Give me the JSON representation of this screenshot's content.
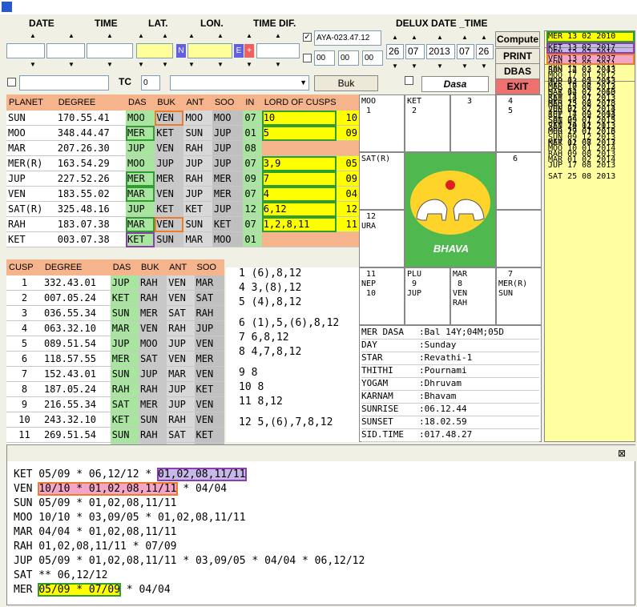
{
  "top_labels": {
    "date": "DATE",
    "time": "TIME",
    "lat": "LAT.",
    "lon": "LON.",
    "time_dif": "TIME DIF.",
    "delux": "DELUX DATE _TIME"
  },
  "inputs": {
    "ayanamsa": "AYA-023.47.12",
    "t1": "00",
    "t2": "00",
    "t3": "00",
    "dd": "26",
    "mm": "07",
    "yyyy": "2013",
    "hh": "07",
    "min": "26",
    "tc_label": "TC",
    "tc_value": "0",
    "n_badge": "N",
    "e_badge": "E",
    "plus": "+"
  },
  "buttons": {
    "compute": "Compute",
    "print": "PRINT",
    "dbas": "DBAS",
    "exit": "EXIT",
    "buk": "Buk",
    "dasa": "Dasa"
  },
  "planet_table": {
    "headers": [
      "PLANET",
      "DEGREE",
      "DAS",
      "BUK",
      "ANT",
      "SOO",
      "IN",
      "LORD OF CUSPS"
    ],
    "rows": [
      [
        "SUN",
        "170.55.41",
        "MOO",
        "VEN",
        "MOO",
        "MOO",
        "07",
        "10",
        "10"
      ],
      [
        "MOO",
        "348.44.47",
        "MER",
        "KET",
        "SUN",
        "JUP",
        "01",
        "5",
        "09"
      ],
      [
        "MAR",
        "207.26.30",
        "JUP",
        "VEN",
        "RAH",
        "JUP",
        "08",
        "",
        ""
      ],
      [
        "MER(R)",
        "163.54.29",
        "MOO",
        "JUP",
        "JUP",
        "JUP",
        "07",
        "3,9",
        "05"
      ],
      [
        "JUP",
        "227.52.26",
        "MER",
        "MER",
        "RAH",
        "MER",
        "09",
        "7",
        "09"
      ],
      [
        "VEN",
        "183.55.02",
        "MAR",
        "VEN",
        "JUP",
        "MER",
        "07",
        "4",
        "04"
      ],
      [
        "SAT(R)",
        "325.48.16",
        "JUP",
        "KET",
        "KET",
        "JUP",
        "12",
        "6,12",
        "12"
      ],
      [
        "RAH",
        "183.07.38",
        "MAR",
        "VEN",
        "SUN",
        "KET",
        "07",
        "1,2,8,11",
        "11"
      ],
      [
        "KET",
        "003.07.38",
        "KET",
        "SUN",
        "MAR",
        "MOO",
        "01",
        "",
        ""
      ]
    ]
  },
  "cusp_table": {
    "headers": [
      "CUSP",
      "DEGREE",
      "DAS",
      "BUK",
      "ANT",
      "SOO"
    ],
    "rows": [
      [
        "1",
        "332.43.01",
        "JUP",
        "RAH",
        "VEN",
        "MAR"
      ],
      [
        "2",
        "007.05.24",
        "KET",
        "RAH",
        "VEN",
        "SAT"
      ],
      [
        "3",
        "036.55.34",
        "SUN",
        "MER",
        "SAT",
        "RAH"
      ],
      [
        "4",
        "063.32.10",
        "MAR",
        "VEN",
        "RAH",
        "JUP"
      ],
      [
        "5",
        "089.51.54",
        "JUP",
        "MOO",
        "JUP",
        "VEN"
      ],
      [
        "6",
        "118.57.55",
        "MER",
        "SAT",
        "VEN",
        "MER"
      ],
      [
        "7",
        "152.43.01",
        "SUN",
        "JUP",
        "MAR",
        "VEN"
      ],
      [
        "8",
        "187.05.24",
        "RAH",
        "RAH",
        "JUP",
        "KET"
      ],
      [
        "9",
        "216.55.34",
        "SAT",
        "MER",
        "JUP",
        "VEN"
      ],
      [
        "10",
        "243.32.10",
        "KET",
        "SUN",
        "RAH",
        "VEN"
      ],
      [
        "11",
        "269.51.54",
        "SUN",
        "RAH",
        "SAT",
        "KET"
      ],
      [
        "12",
        "298.57.55",
        "MAR",
        "SAT",
        "VEN",
        "MER"
      ]
    ]
  },
  "cusp_significators": [
    "1 (6),8,12",
    "4 3,(8),12",
    "5 (4),8,12",
    "6 (1),5,(6),8,12",
    "7 6,8,12",
    "8 4,7,8,12",
    "9 8",
    "10 8",
    "11 8,12",
    "12 5,(6),7,8,12"
  ],
  "chart_cells": {
    "c00": "MOO\n 1",
    "c01": "KET\n 2",
    "c02": "   3",
    "c03": "  4\n  5",
    "c10": "SAT(R)",
    "c13": "   6",
    "c20": " 12\nURA",
    "c30": " 11\nNEP\n 10",
    "c31": "PLU\n 9\nJUP",
    "c32": "MAR\n 8\nVEN\nRAH",
    "c33": "  7\nMER(R)\nSUN",
    "center": "BHAVA"
  },
  "info": [
    [
      "MER DASA",
      ":Bal 14Y;04M;05D"
    ],
    [
      "DAY",
      ":Sunday"
    ],
    [
      "STAR",
      ":Revathi-1"
    ],
    [
      "THITHI",
      ":Pournami"
    ],
    [
      "YOGAM",
      ":Dhruvam"
    ],
    [
      "KARNAM",
      ":Bhavam"
    ],
    [
      "SUNRISE",
      ":06.12.44"
    ],
    [
      "SUNSET",
      ":18.02.59"
    ],
    [
      "SID.TIME",
      ":017.48.27"
    ]
  ],
  "dasa_list": {
    "g1": [
      "MER 13 02 2010",
      "KET 13 02 2017",
      "VEN 13 02 2037",
      "SUN 14 02 2043",
      "MOO 13 02 2053",
      "MAR 14 02 2060",
      "RAH 13 02 2078",
      "JUP 14 02 2094",
      "SAT 14 02 2113"
    ],
    "g2": [
      "VEN 12 07 2010",
      "SUN 12 09 2011",
      "MOO 17 01 2012",
      "MAR 17 08 2012",
      "RAH 14 01 2013",
      "JUP 01 02 2014",
      "SAT 09 01 2015",
      "MER 17 01 2016",
      "KET 12 07 2017"
    ],
    "g3": [
      "RAH 12 03 2013",
      "JUP 02 05 2013",
      "SAT 02 07 2013",
      "MER 25 08 2013",
      "KET 17 09 2013",
      "VEN 20 11 2013",
      "SUN 09 12 2013",
      "MOO 10 01 2014",
      "MAR 01 02 2014"
    ],
    "g4": [
      "MER 10 07 2013",
      "KET 13 07 2013",
      "VEN 22 07 2013",
      "SUN 25 07 2013",
      "MOO 29 07 2013",
      "MAR 01 08 2013",
      "RAH 09 08 2013",
      "JUP 17 08 2013",
      "SAT 25 08 2013"
    ]
  },
  "bottom_lines": [
    [
      "KET 05/09 * 06,12/12 * ",
      "01,02,08,11/11",
      ""
    ],
    [
      "VEN ",
      "10/10 * 01,02,08,11/11",
      " * 04/04"
    ],
    [
      "SUN 05/09 * 01,02,08,11/11",
      "",
      ""
    ],
    [
      "MOO 10/10 * 03,09/05 * 01,02,08,11/11",
      "",
      ""
    ],
    [
      "MAR 04/04 * 01,02,08,11/11",
      "",
      ""
    ],
    [
      "RAH 01,02,08,11/11 * 07/09",
      "",
      ""
    ],
    [
      "JUP 05/09 * 01,02,08,11/11 * 03,09/05 * 04/04 * 06,12/12",
      "",
      ""
    ],
    [
      "SAT ** 06,12/12",
      "",
      ""
    ],
    [
      "MER ",
      "05/09 * 07/09",
      " * 04/04"
    ]
  ],
  "close_glyph": "⊠",
  "colors": {
    "title": "#2858d0",
    "peach": "#f5b48c",
    "green": "#a8e6a0",
    "yellow": "#ffff00",
    "orange_box": "#f07b2a",
    "green_box": "#2e9e2e",
    "purple_box": "#8a3fb0",
    "pink": "#f4a6c8",
    "lavender": "#c6b8e8"
  }
}
